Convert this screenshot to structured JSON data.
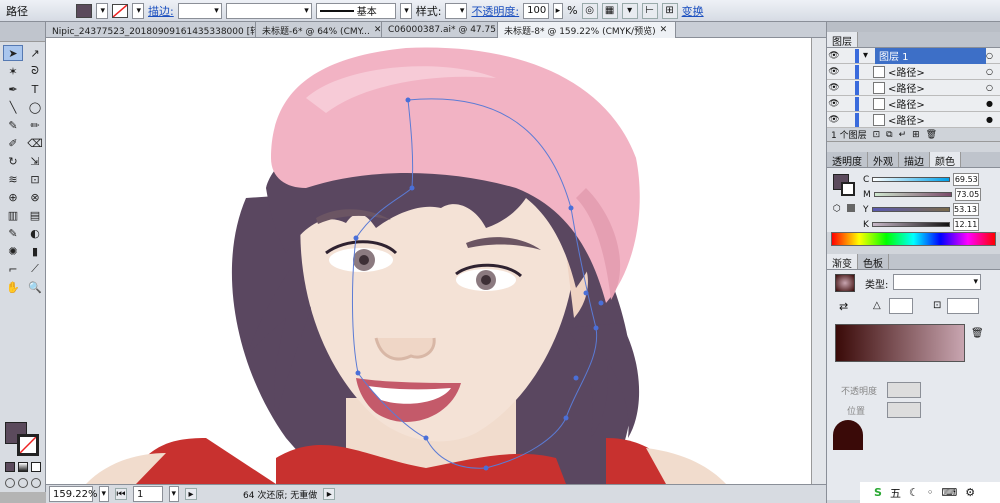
{
  "control_bar": {
    "object_type": "路径",
    "stroke_label": "描边:",
    "line_style_label": "基本",
    "style_label": "样式:",
    "opacity_label": "不透明度:",
    "opacity_value": "100",
    "percent": "%",
    "transform_label": "变换"
  },
  "document_tabs": [
    {
      "label": "Nipic_24377523_20180909161435338000 [转换].ai*",
      "active": false
    },
    {
      "label": "未标题-6* @ 64% (CMY...",
      "active": false
    },
    {
      "label": "C06000387.ai* @ 47.75...",
      "active": false
    },
    {
      "label": "未标题-8* @ 159.22% (CMYK/预览)",
      "active": true
    }
  ],
  "status_bar": {
    "zoom": "159.22%",
    "page": "1",
    "message": "64 次还原; 无重做"
  },
  "layers_panel": {
    "tab": "图层",
    "rows": [
      {
        "name": "图层 1",
        "highlight": true
      },
      {
        "name": "<路径>",
        "highlight": false
      },
      {
        "name": "<路径>",
        "highlight": false
      },
      {
        "name": "<路径>",
        "highlight": false
      },
      {
        "name": "<路径>",
        "highlight": false
      }
    ],
    "count": "1 个图层"
  },
  "color_panel": {
    "tabs": [
      "透明度",
      "外观",
      "描边",
      "颜色"
    ],
    "channels": [
      {
        "name": "C",
        "value": "69.53"
      },
      {
        "name": "M",
        "value": "73.05"
      },
      {
        "name": "Y",
        "value": "53.13"
      },
      {
        "name": "K",
        "value": "12.11"
      }
    ]
  },
  "gradient_panel": {
    "tabs": [
      "渐变",
      "色板"
    ],
    "type_label": "类型:",
    "angle_label": "角度",
    "opacity_label": "不透明度",
    "position_label": "位置"
  },
  "taskbar": {
    "labels": [
      "五"
    ]
  },
  "colors": {
    "fill": "#5b4a5c",
    "hat": "#f2b3c4",
    "hair": "#5a4760",
    "skin": "#f4e2d6",
    "shirt": "#c8312f",
    "path": "#5b7bd5",
    "gradient_start": "#3a0a08",
    "gradient_end": "#c8a5b0"
  }
}
